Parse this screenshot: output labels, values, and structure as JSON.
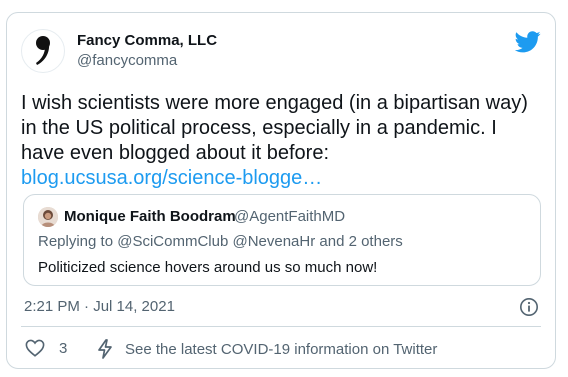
{
  "author": {
    "name": "Fancy Comma, LLC",
    "handle": "@fancycomma"
  },
  "tweet": {
    "text": "I wish scientists were more engaged (in a bipartisan way) in the US political process, especially in a pandemic. I have even blogged about it before: ",
    "link": "blog.ucsusa.org/science-blogge…"
  },
  "quoted_tweet": {
    "name": "Monique Faith Boodram",
    "handle": "@AgentFaithMD",
    "reply_prefix": "Replying to ",
    "reply_to": "@SciCommClub @NevenaHr and 2 others",
    "text": "Politicized science hovers around us so much now!"
  },
  "meta": {
    "timestamp": "2:21 PM · Jul 14, 2021"
  },
  "footer": {
    "like_count": "3",
    "covid_text": "See the latest COVID-19 information on Twitter"
  },
  "colors": {
    "twitter_blue": "#1d9bf0",
    "secondary_text": "#536471",
    "border": "#cfd9de"
  },
  "icons": [
    "twitter-bird-icon",
    "heart-icon",
    "bolt-icon",
    "info-icon"
  ]
}
